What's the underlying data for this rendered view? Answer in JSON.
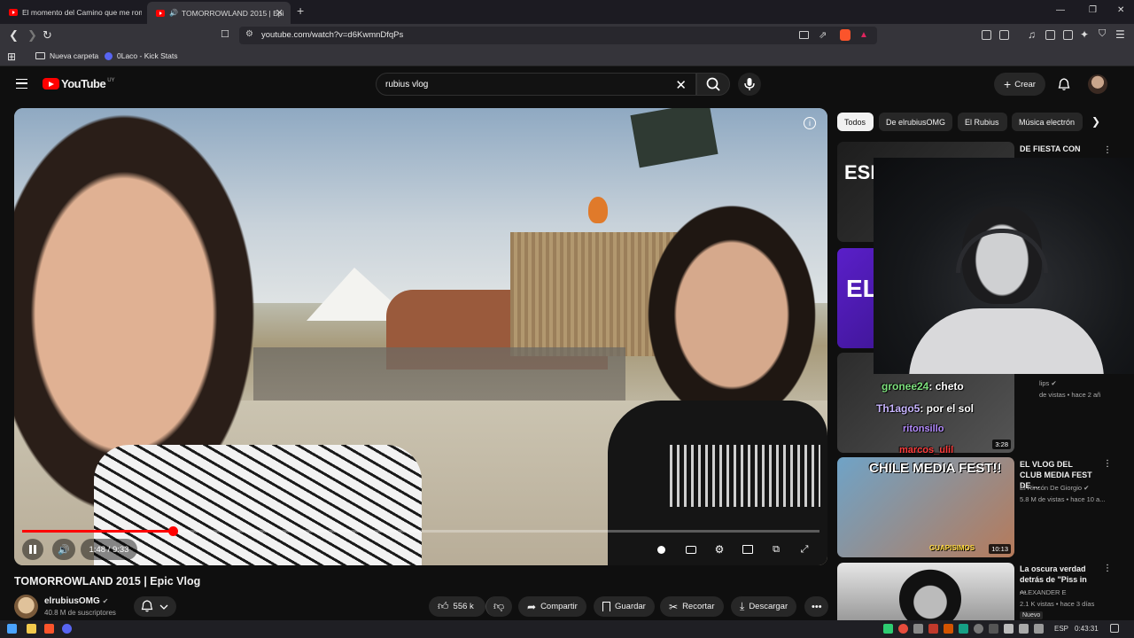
{
  "browser": {
    "tabs": [
      {
        "title": "El momento del Camino que me rom",
        "active": false
      },
      {
        "title": "TOMORROWLAND 2015 | Epi",
        "active": true
      }
    ],
    "url": "youtube.com/watch?v=d6KwmnDfqPs",
    "bookmarks": [
      "Nueva carpeta",
      "0Laco - Kick Stats"
    ]
  },
  "yt": {
    "logo_text": "YouTube",
    "region": "UY",
    "search_query": "rubius vlog",
    "create_label": "Crear"
  },
  "player": {
    "time_display": "1:48 / 9:33",
    "progress_fraction": 0.189
  },
  "video": {
    "title": "TOMORROWLAND 2015 | Epic Vlog",
    "channel": "elrubiusOMG",
    "subscribers": "40.8 M de suscriptores",
    "likes": "556 k",
    "share": "Compartir",
    "save": "Guardar",
    "clip": "Recortar",
    "download": "Descargar"
  },
  "chips": [
    "Todos",
    "De elrubiusOMG",
    "El Rubius",
    "Música electrón"
  ],
  "recommendations": [
    {
      "title": "DE FIESTA CON",
      "channel": "",
      "meta": "",
      "thumb_text": "ESP 6",
      "duration": ""
    },
    {
      "title": "",
      "channel": "",
      "meta": "",
      "thumb_text": "EL VL",
      "duration": ""
    },
    {
      "title": "",
      "channel": "lips",
      "meta": "de vistas • hace 2 añ",
      "thumb_text": "",
      "duration": "3:28"
    },
    {
      "title": "EL VLOG DEL CLUB MEDIA FEST DE ...",
      "channel": "El Rincón De Giorgio",
      "meta": "5.8 M de vistas • hace 10 a...",
      "thumb_text": "CHILE MEDIA FEST!!",
      "thumb_sub": "GUAPISIMOS",
      "duration": "10:13"
    },
    {
      "title": "La oscura verdad detrás de \"Piss in ...",
      "channel": "ALEXANDER E",
      "meta": "2.1 K vistas • hace 3 días",
      "badge": "Nuevo",
      "duration": ""
    }
  ],
  "overlay_chat": [
    {
      "user": "gronee24",
      "msg": ": cheto"
    },
    {
      "user": "Th1ago5",
      "msg": ": por el sol"
    },
    {
      "user": "ritonsillo",
      "msg": ""
    },
    {
      "user": "marcos_ulil",
      "msg": ""
    }
  ],
  "taskbar": {
    "lang": "ESP",
    "time": "0:43:31"
  }
}
